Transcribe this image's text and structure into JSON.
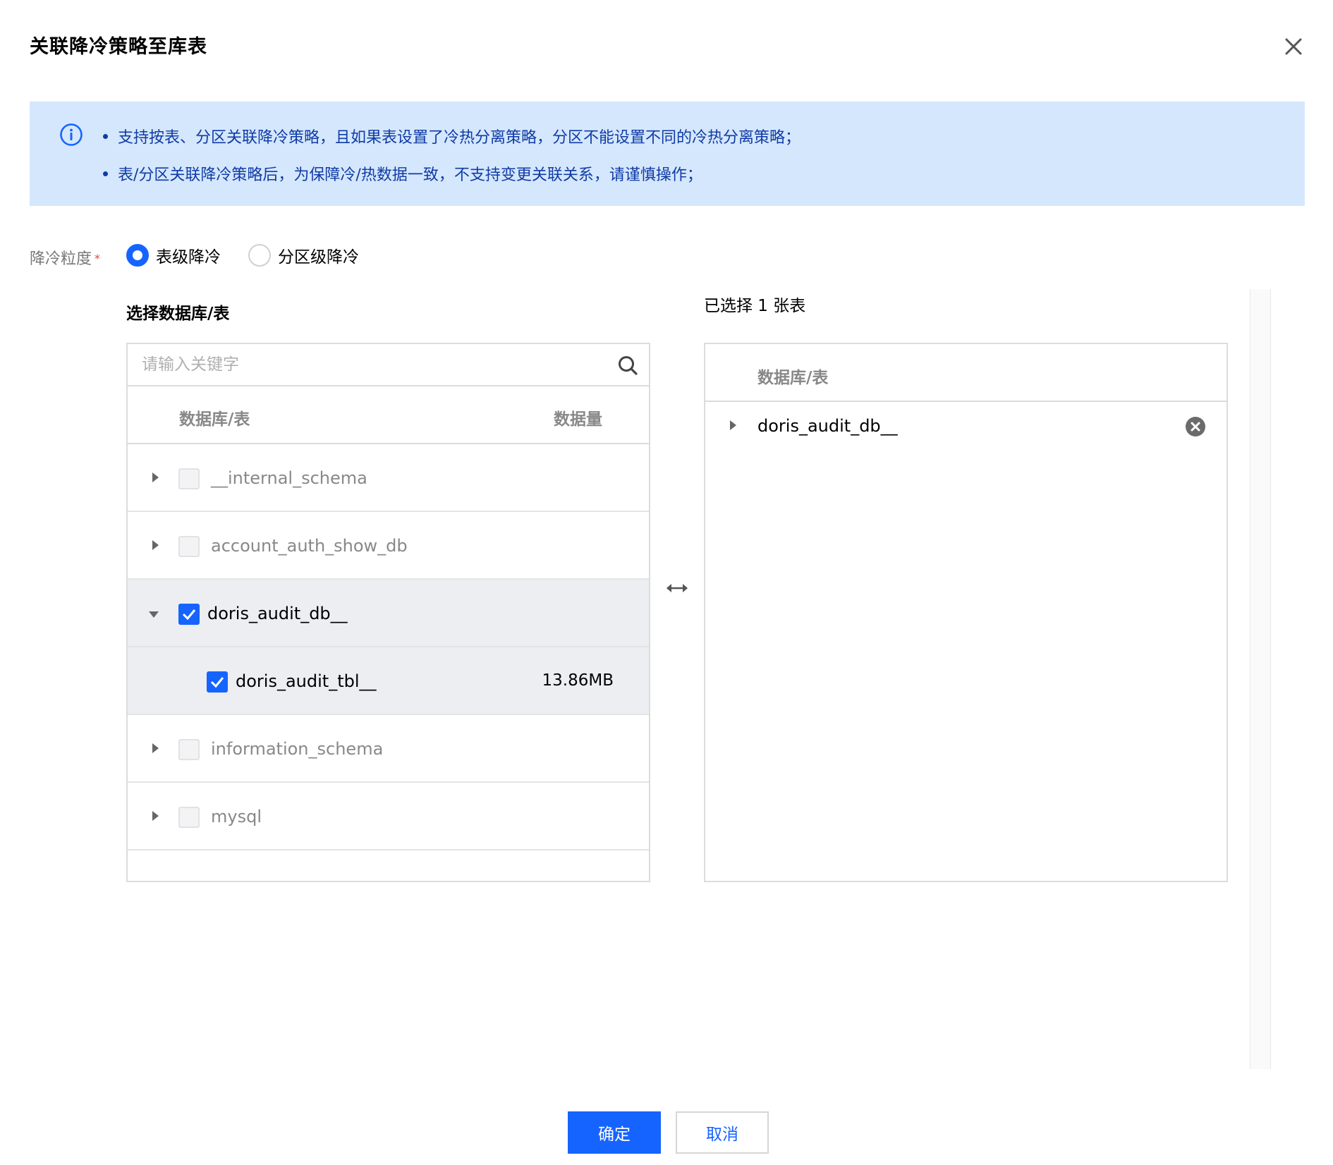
{
  "dialog": {
    "title": "关联降冷策略至库表",
    "close_icon": "close-icon"
  },
  "notice": {
    "icon": "info-icon",
    "lines": [
      "支持按表、分区关联降冷策略，且如果表设置了冷热分离策略，分区不能设置不同的冷热分离策略；",
      "表/分区关联降冷策略后，为保障冷/热数据一致，不支持变更关联关系，请谨慎操作；"
    ]
  },
  "granularity": {
    "label": "降冷粒度",
    "required_mark": "*",
    "options": [
      {
        "label": "表级降冷",
        "checked": true
      },
      {
        "label": "分区级降冷",
        "checked": false
      }
    ]
  },
  "left": {
    "title": "选择数据库/表",
    "search_placeholder": "请输入关键字",
    "columns": [
      "数据库/表",
      "数据量"
    ],
    "rows": [
      {
        "name": "__internal_schema",
        "level": 0,
        "expanded": false,
        "checked": false,
        "size": ""
      },
      {
        "name": "account_auth_show_db",
        "level": 0,
        "expanded": false,
        "checked": false,
        "size": ""
      },
      {
        "name": "doris_audit_db__",
        "level": 0,
        "expanded": true,
        "checked": true,
        "size": ""
      },
      {
        "name": "doris_audit_tbl__",
        "level": 1,
        "expanded": false,
        "checked": true,
        "size": "13.86MB"
      },
      {
        "name": "information_schema",
        "level": 0,
        "expanded": false,
        "checked": false,
        "size": ""
      },
      {
        "name": "mysql",
        "level": 0,
        "expanded": false,
        "checked": false,
        "size": ""
      }
    ]
  },
  "right": {
    "title": "已选择 1 张表",
    "column": "数据库/表",
    "items": [
      {
        "name": "doris_audit_db__"
      }
    ]
  },
  "footer": {
    "ok_label": "确定",
    "cancel_label": "取消"
  },
  "colors": {
    "primary": "#1664ff",
    "notice_bg": "#d5e7fd",
    "notice_text": "#0f3ba6",
    "required": "#e54545"
  }
}
